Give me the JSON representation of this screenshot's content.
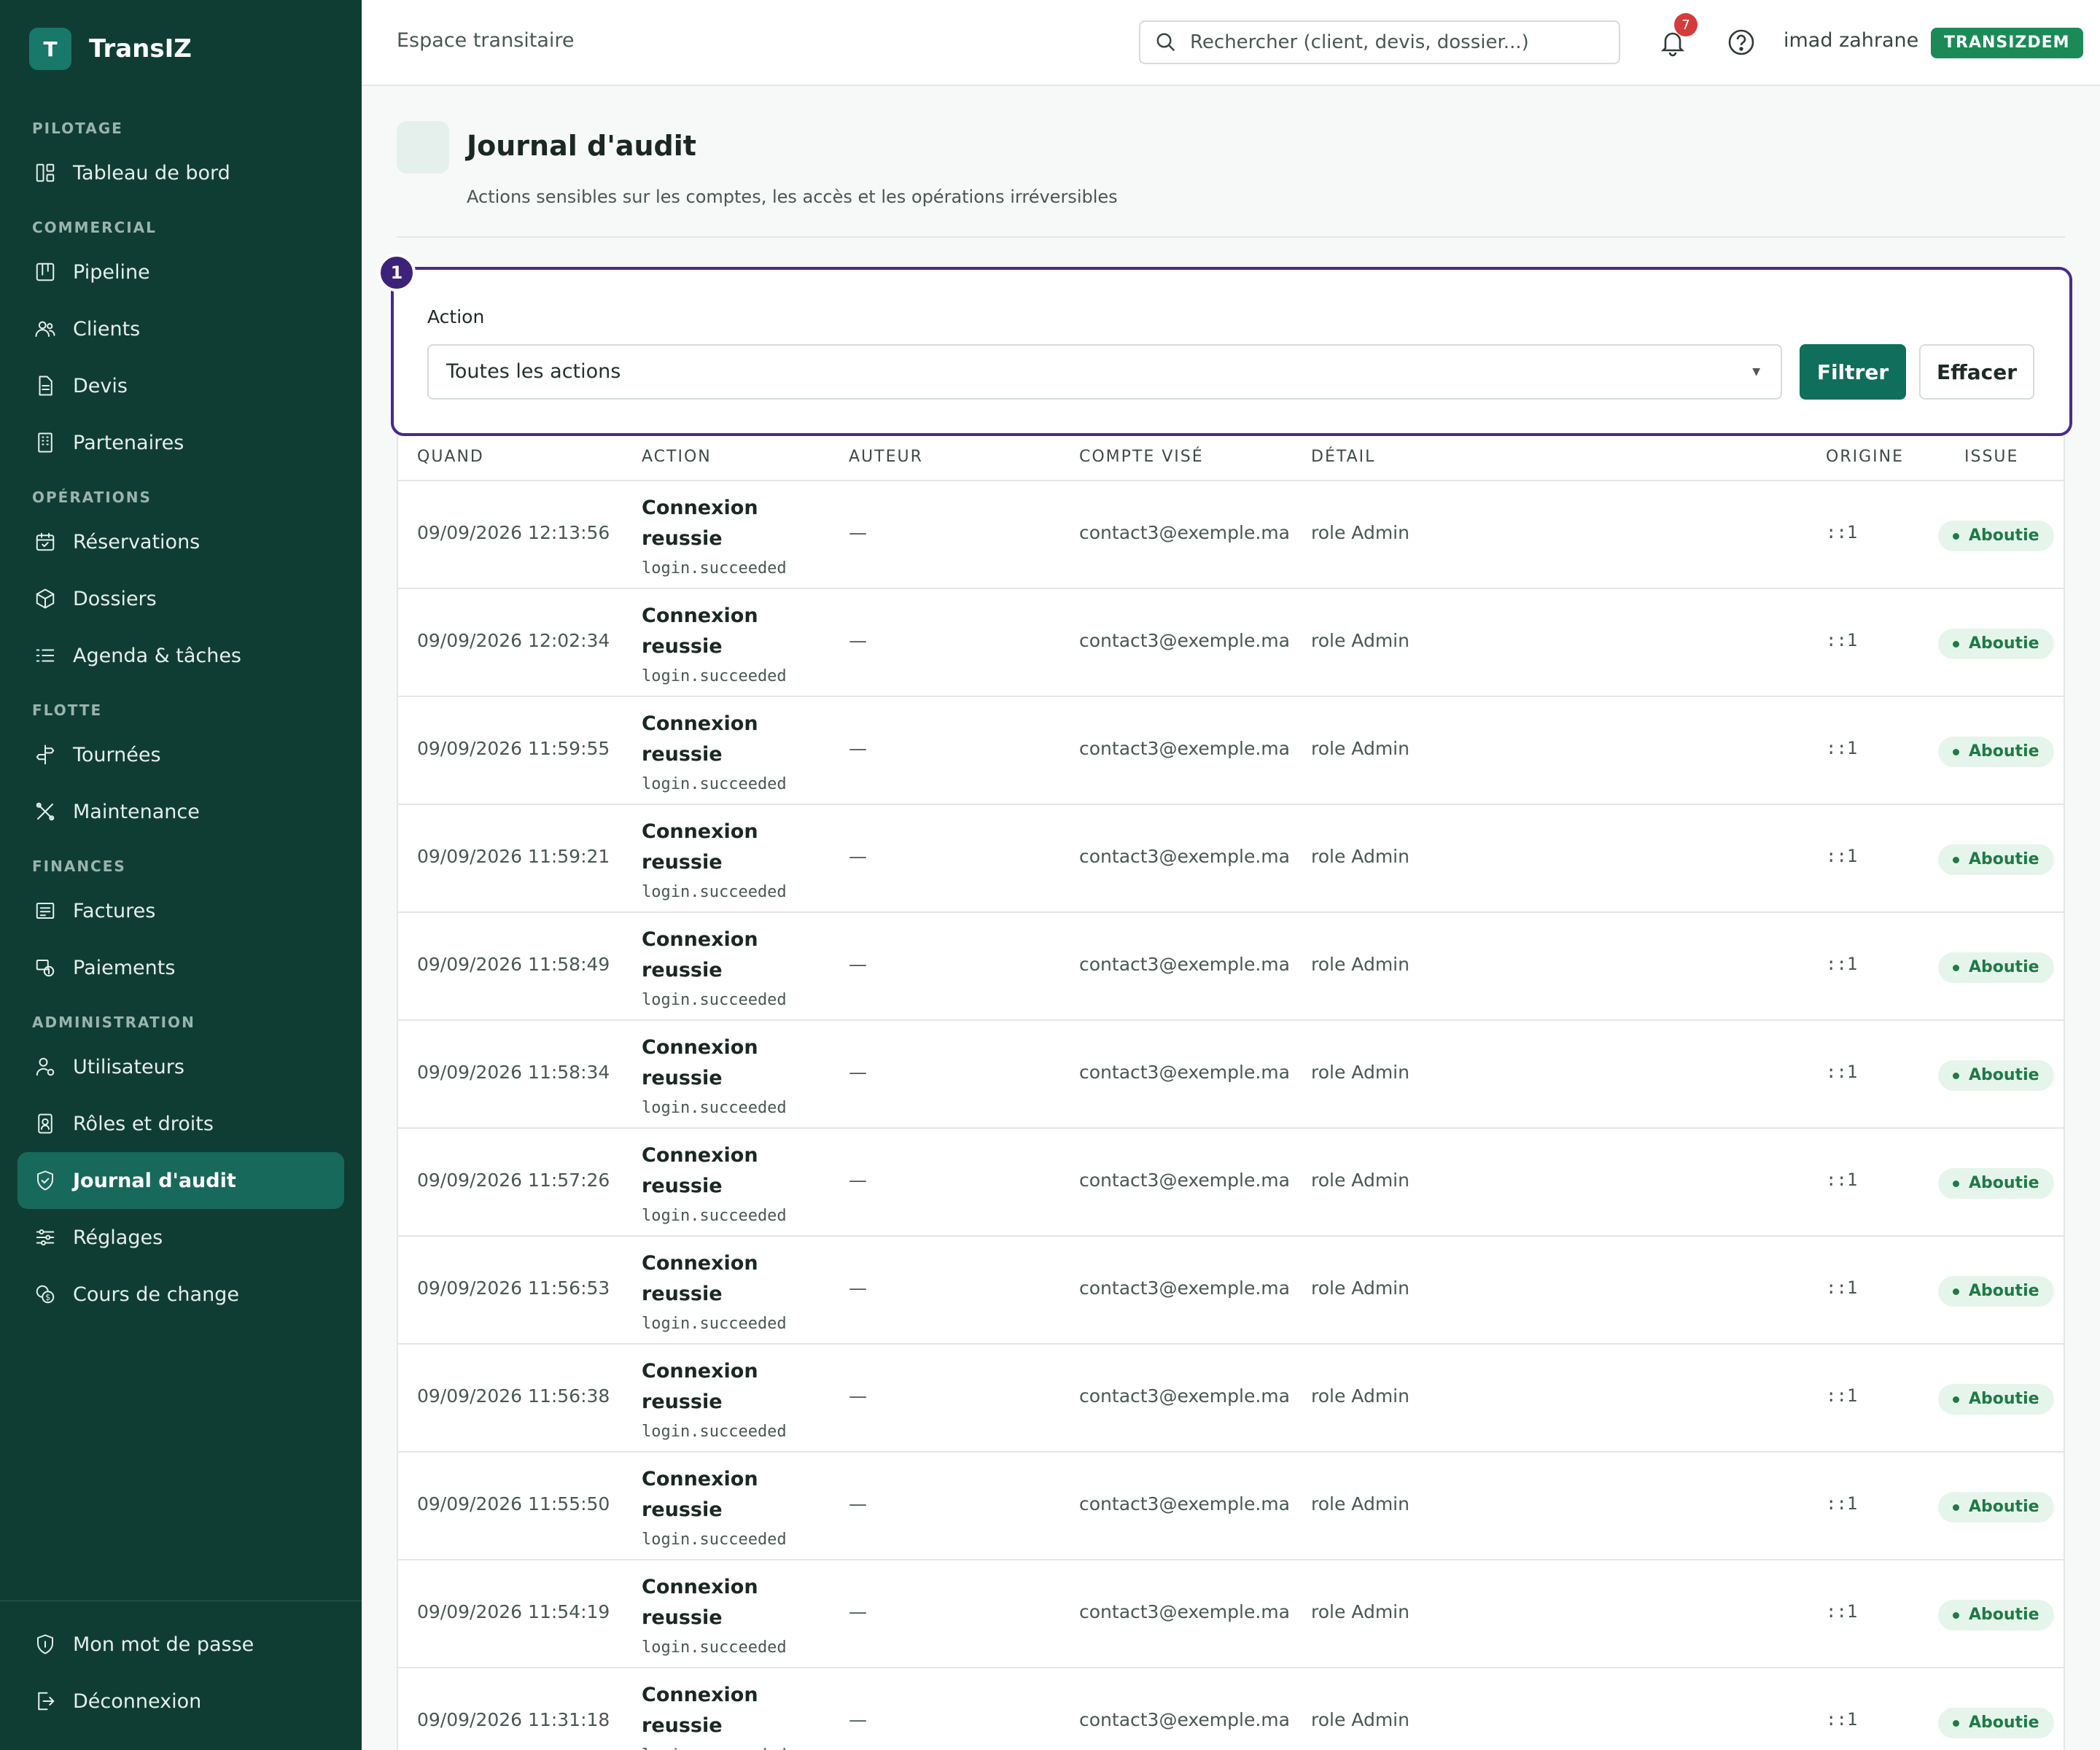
{
  "app": {
    "logo_letter": "T",
    "name": "TransIZ"
  },
  "sidebar": {
    "sections": [
      {
        "title": "PILOTAGE",
        "items": [
          {
            "label": "Tableau de bord",
            "icon": "dashboard-icon"
          }
        ]
      },
      {
        "title": "COMMERCIAL",
        "items": [
          {
            "label": "Pipeline",
            "icon": "kanban-icon"
          },
          {
            "label": "Clients",
            "icon": "users-icon"
          },
          {
            "label": "Devis",
            "icon": "document-icon"
          },
          {
            "label": "Partenaires",
            "icon": "building-icon"
          }
        ]
      },
      {
        "title": "OPÉRATIONS",
        "items": [
          {
            "label": "Réservations",
            "icon": "calendar-check-icon"
          },
          {
            "label": "Dossiers",
            "icon": "box-icon"
          },
          {
            "label": "Agenda & tâches",
            "icon": "list-icon"
          }
        ]
      },
      {
        "title": "FLOTTE",
        "items": [
          {
            "label": "Tournées",
            "icon": "signpost-icon"
          },
          {
            "label": "Maintenance",
            "icon": "tools-icon"
          }
        ]
      },
      {
        "title": "FINANCES",
        "items": [
          {
            "label": "Factures",
            "icon": "invoice-icon"
          },
          {
            "label": "Paiements",
            "icon": "payment-icon"
          }
        ]
      },
      {
        "title": "ADMINISTRATION",
        "items": [
          {
            "label": "Utilisateurs",
            "icon": "user-settings-icon"
          },
          {
            "label": "Rôles et droits",
            "icon": "id-badge-icon"
          },
          {
            "label": "Journal d'audit",
            "icon": "shield-check-icon",
            "active": true
          },
          {
            "label": "Réglages",
            "icon": "sliders-icon"
          },
          {
            "label": "Cours de change",
            "icon": "coins-icon"
          }
        ]
      }
    ],
    "bottom": [
      {
        "label": "Mon mot de passe",
        "icon": "shield-lock-icon"
      },
      {
        "label": "Déconnexion",
        "icon": "logout-icon"
      }
    ]
  },
  "topbar": {
    "breadcrumb": "Espace transitaire",
    "search_placeholder": "Rechercher (client, devis, dossier...)",
    "notifications": "7",
    "username": "imad zahrane",
    "tenant": "TRANSIZDEM"
  },
  "page": {
    "title": "Journal d'audit",
    "subtitle": "Actions sensibles sur les comptes, les accès et les opérations irréversibles"
  },
  "filter": {
    "step": "1",
    "label": "Action",
    "selected": "Toutes les actions",
    "filter_button": "Filtrer",
    "clear_button": "Effacer"
  },
  "table": {
    "columns": [
      {
        "key": "when",
        "label": "QUAND"
      },
      {
        "key": "action",
        "label": "ACTION"
      },
      {
        "key": "author",
        "label": "AUTEUR"
      },
      {
        "key": "target",
        "label": "COMPTE VISÉ"
      },
      {
        "key": "detail",
        "label": "DÉTAIL"
      },
      {
        "key": "origin",
        "label": "ORIGINE"
      },
      {
        "key": "status",
        "label": "ISSUE"
      }
    ],
    "rows": [
      {
        "when": "09/09/2026 12:13:56",
        "action1": "Connexion",
        "action2": "reussie",
        "code": "login.succeeded",
        "author": "—",
        "target": "contact3@exemple.ma",
        "detail": "role Admin",
        "origin": "::1",
        "status": "Aboutie"
      },
      {
        "when": "09/09/2026 12:02:34",
        "action1": "Connexion",
        "action2": "reussie",
        "code": "login.succeeded",
        "author": "—",
        "target": "contact3@exemple.ma",
        "detail": "role Admin",
        "origin": "::1",
        "status": "Aboutie"
      },
      {
        "when": "09/09/2026 11:59:55",
        "action1": "Connexion",
        "action2": "reussie",
        "code": "login.succeeded",
        "author": "—",
        "target": "contact3@exemple.ma",
        "detail": "role Admin",
        "origin": "::1",
        "status": "Aboutie"
      },
      {
        "when": "09/09/2026 11:59:21",
        "action1": "Connexion",
        "action2": "reussie",
        "code": "login.succeeded",
        "author": "—",
        "target": "contact3@exemple.ma",
        "detail": "role Admin",
        "origin": "::1",
        "status": "Aboutie"
      },
      {
        "when": "09/09/2026 11:58:49",
        "action1": "Connexion",
        "action2": "reussie",
        "code": "login.succeeded",
        "author": "—",
        "target": "contact3@exemple.ma",
        "detail": "role Admin",
        "origin": "::1",
        "status": "Aboutie"
      },
      {
        "when": "09/09/2026 11:58:34",
        "action1": "Connexion",
        "action2": "reussie",
        "code": "login.succeeded",
        "author": "—",
        "target": "contact3@exemple.ma",
        "detail": "role Admin",
        "origin": "::1",
        "status": "Aboutie"
      },
      {
        "when": "09/09/2026 11:57:26",
        "action1": "Connexion",
        "action2": "reussie",
        "code": "login.succeeded",
        "author": "—",
        "target": "contact3@exemple.ma",
        "detail": "role Admin",
        "origin": "::1",
        "status": "Aboutie"
      },
      {
        "when": "09/09/2026 11:56:53",
        "action1": "Connexion",
        "action2": "reussie",
        "code": "login.succeeded",
        "author": "—",
        "target": "contact3@exemple.ma",
        "detail": "role Admin",
        "origin": "::1",
        "status": "Aboutie"
      },
      {
        "when": "09/09/2026 11:56:38",
        "action1": "Connexion",
        "action2": "reussie",
        "code": "login.succeeded",
        "author": "—",
        "target": "contact3@exemple.ma",
        "detail": "role Admin",
        "origin": "::1",
        "status": "Aboutie"
      },
      {
        "when": "09/09/2026 11:55:50",
        "action1": "Connexion",
        "action2": "reussie",
        "code": "login.succeeded",
        "author": "—",
        "target": "contact3@exemple.ma",
        "detail": "role Admin",
        "origin": "::1",
        "status": "Aboutie"
      },
      {
        "when": "09/09/2026 11:54:19",
        "action1": "Connexion",
        "action2": "reussie",
        "code": "login.succeeded",
        "author": "—",
        "target": "contact3@exemple.ma",
        "detail": "role Admin",
        "origin": "::1",
        "status": "Aboutie"
      },
      {
        "when": "09/09/2026 11:31:18",
        "action1": "Connexion",
        "action2": "reussie",
        "code": "login.succeeded",
        "author": "—",
        "target": "contact3@exemple.ma",
        "detail": "role Admin",
        "origin": "::1",
        "status": "Aboutie"
      }
    ]
  }
}
